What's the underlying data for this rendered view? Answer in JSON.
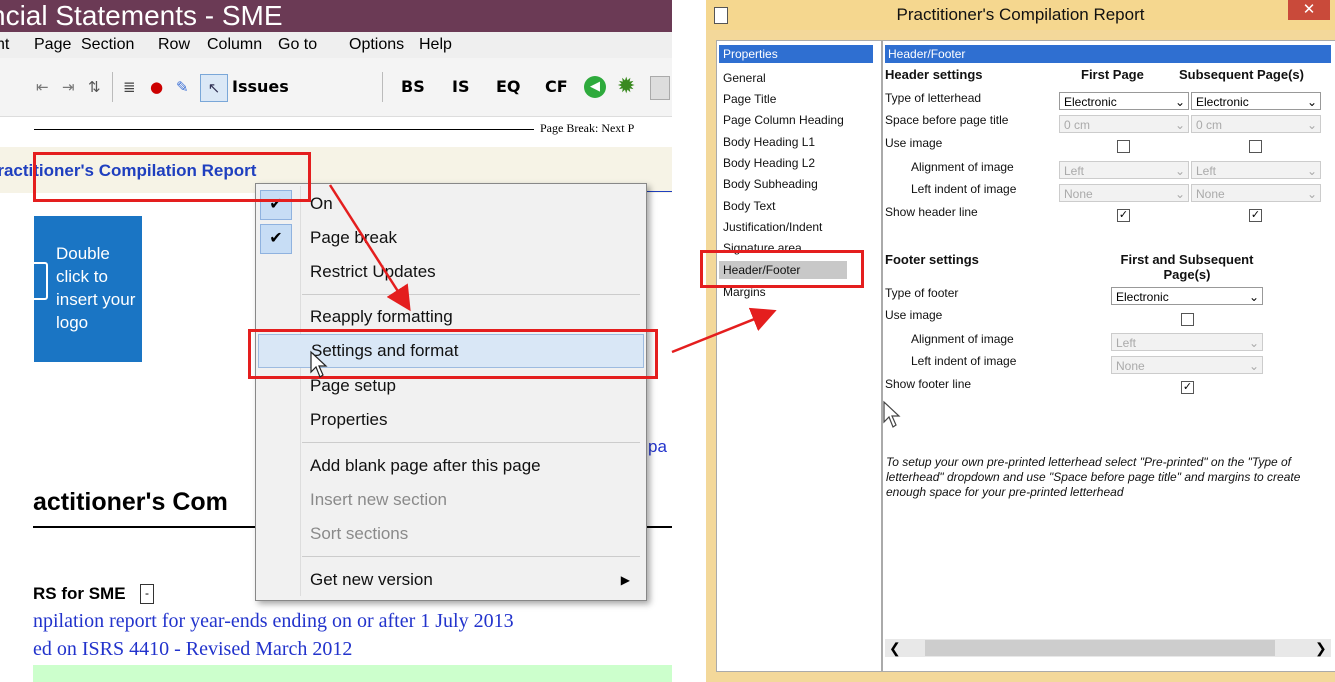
{
  "app": {
    "title": "ncial Statements - SME",
    "menu": [
      "nt",
      "Page",
      "Section",
      "Row",
      "Column",
      "Go to",
      "Options",
      "Help"
    ],
    "toolbar_labels": {
      "issues": "Issues",
      "bs": "BS",
      "is": "IS",
      "eq": "EQ",
      "cf": "CF"
    },
    "page_break_text": "Page Break: Next P",
    "section_tab": "Practitioner's Compilation Report",
    "logo_text": "Double click to insert your logo",
    "doc_heading": "actitioner's Com",
    "isrs_label": "RS for SME",
    "body_line1": "npilation report for year-ends ending on or after 1 July 2013",
    "body_line2": "ed on ISRS 4410 - Revised March 2012",
    "pa_text": "pa"
  },
  "context_menu": {
    "items": [
      {
        "label": "On",
        "checked": true,
        "enabled": true
      },
      {
        "label": "Page break",
        "checked": true,
        "enabled": true
      },
      {
        "label": "Restrict Updates",
        "checked": false,
        "enabled": true
      },
      {
        "label": "Reapply formatting",
        "checked": false,
        "enabled": true
      },
      {
        "label": "Settings and format",
        "checked": false,
        "enabled": true,
        "highlighted": true
      },
      {
        "label": "Page setup",
        "checked": false,
        "enabled": true
      },
      {
        "label": "Properties",
        "checked": false,
        "enabled": true
      },
      {
        "label": "Add blank page after this page",
        "checked": false,
        "enabled": true
      },
      {
        "label": "Insert new section",
        "checked": false,
        "enabled": false
      },
      {
        "label": "Sort sections",
        "checked": false,
        "enabled": false
      },
      {
        "label": "Get new version",
        "checked": false,
        "enabled": true,
        "submenu": true
      }
    ]
  },
  "dialog": {
    "title": "Practitioner's Compilation Report",
    "close": "✕",
    "nav": [
      "Properties",
      "General",
      "Page Title",
      "Page Column Heading",
      "Body Heading L1",
      "Body Heading L2",
      "Body Subheading",
      "Body Text",
      "Justification/Indent",
      "Signature area",
      "Header/Footer",
      "Margins"
    ],
    "panel_title": "Header/Footer",
    "header": {
      "section": "Header settings",
      "col1": "First Page",
      "col2": "Subsequent Page(s)",
      "type_label": "Type of letterhead",
      "type_first": "Electronic",
      "type_subsequent": "Electronic",
      "space_label": "Space before page title",
      "space_first": "0 cm",
      "space_subsequent": "0 cm",
      "use_image_label": "Use image",
      "use_image_first": false,
      "use_image_subsequent": false,
      "align_label": "Alignment of image",
      "align_first": "Left",
      "align_subsequent": "Left",
      "indent_label": "Left indent of image",
      "indent_first": "None",
      "indent_subsequent": "None",
      "line_label": "Show header line",
      "line_first": true,
      "line_subsequent": true
    },
    "footer": {
      "section": "Footer settings",
      "col": "First and Subsequent Page(s)",
      "type_label": "Type of footer",
      "type_value": "Electronic",
      "use_image_label": "Use image",
      "use_image": false,
      "align_label": "Alignment of image",
      "align_value": "Left",
      "indent_label": "Left indent of image",
      "indent_value": "None",
      "line_label": "Show footer line",
      "line_value": true
    },
    "note": "To setup your own pre-printed letterhead select \"Pre-printed\" on the \"Type of letterhead\" dropdown and use \"Space before page title\" and margins to create enough space for your pre-printed letterhead"
  },
  "colors": {
    "annotation": "#e41e1e",
    "title_bar": "#6b3a55",
    "selection": "#2f6fd1",
    "dialog_frame": "#f3d89a"
  }
}
